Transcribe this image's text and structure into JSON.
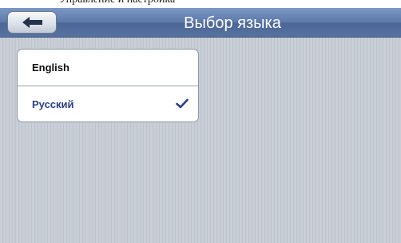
{
  "header": {
    "title": "Выбор языка",
    "back_icon": "arrow-left-icon"
  },
  "languages": [
    {
      "label": "English",
      "selected": false
    },
    {
      "label": "Русский",
      "selected": true,
      "check_icon": "checkmark-icon"
    }
  ],
  "colors": {
    "header": "#5c79a9",
    "selected_text": "#27408a",
    "background": "#c6cbd4"
  }
}
